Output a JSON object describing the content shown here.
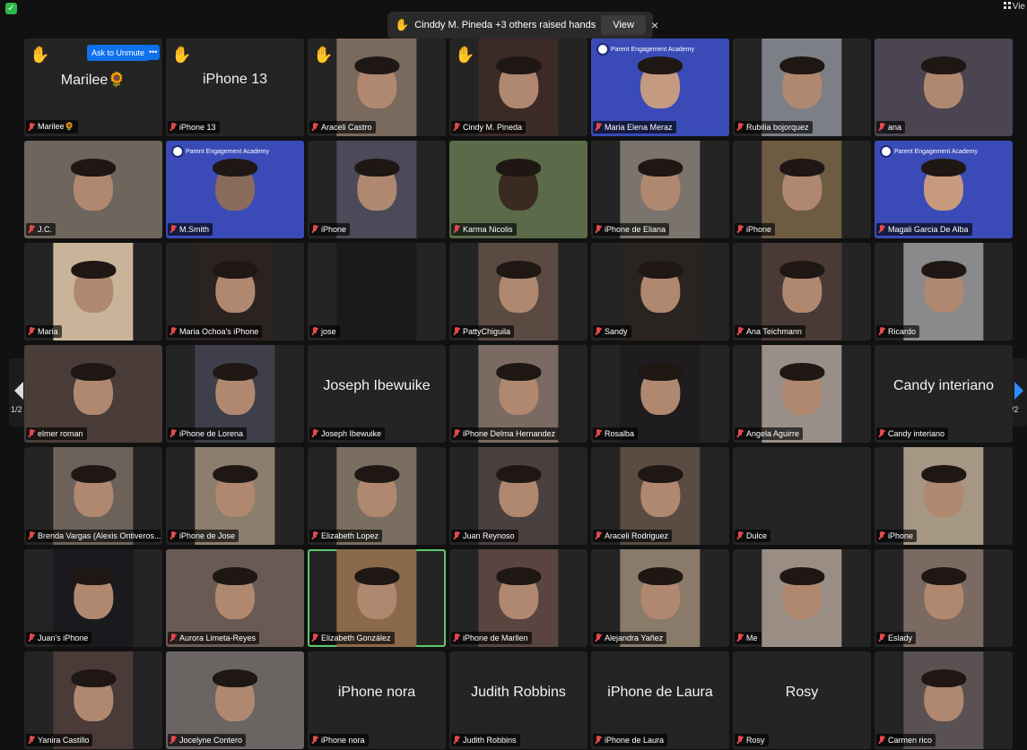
{
  "top": {
    "view_label": "Vie",
    "raise_banner": {
      "message": "Cinddy M. Pineda +3 others raised hands",
      "view_button": "View",
      "close": "×"
    }
  },
  "ask_to_unmute": "Ask to Unmute",
  "more": "•••",
  "academy_logo": "Parent Engagement Academy",
  "pager": {
    "left": "1/2",
    "right": "1/2"
  },
  "tiles": [
    {
      "label": "Marilee🌻",
      "big": "Marilee🌻",
      "hand": true,
      "ask": true
    },
    {
      "label": "iPhone 13",
      "big": "iPhone 13",
      "hand": true
    },
    {
      "label": "Araceli Castro",
      "hand": true,
      "video": "#7a6a5e"
    },
    {
      "label": "Cindy M. Pineda",
      "hand": true,
      "video": "#3b2a26"
    },
    {
      "label": "Maria Elena Meraz",
      "video": "#3a4bb8",
      "wide": true,
      "logo": true,
      "skin": "#c49a80"
    },
    {
      "label": "Rubilia bojorquez",
      "video": "#7d7f86"
    },
    {
      "label": "ana",
      "video": "#4a4550",
      "wide": true
    },
    {
      "label": "J.C.",
      "video": "#6e655c",
      "wide": true
    },
    {
      "label": "M.Smith",
      "video": "#3a4bb8",
      "wide": true,
      "logo": true,
      "skin": "#8a6a5a"
    },
    {
      "label": "iPhone",
      "video": "#4c4a58"
    },
    {
      "label": "Karma Nicolis",
      "video": "#5b6b4a",
      "wide": true,
      "skin": "#3a2a22"
    },
    {
      "label": "iPhone de Eliana",
      "video": "#7a746c"
    },
    {
      "label": "iPhone",
      "video": "#6d5c42"
    },
    {
      "label": "Magali Garcia De Alba",
      "video": "#3a4bb8",
      "wide": true,
      "logo": true,
      "skin": "#c79a7d"
    },
    {
      "label": "Maria",
      "video": "#c9b49a"
    },
    {
      "label": "Maria Ochoa's iPhone",
      "video": "#2b2320"
    },
    {
      "label": "jose",
      "video": "#1a1a1a"
    },
    {
      "label": "PattyChiguila",
      "video": "#5a4a42"
    },
    {
      "label": "Sandy",
      "video": "#2a2420"
    },
    {
      "label": "Ana Teichmann",
      "video": "#4a3a36"
    },
    {
      "label": "Ricardo",
      "video": "#8a8a8c"
    },
    {
      "label": "elmer roman",
      "video": "#4a3c38",
      "wide": true
    },
    {
      "label": "iPhone de Lorena",
      "video": "#3e3f4a"
    },
    {
      "label": "Joseph Ibewuike",
      "big": "Joseph Ibewuike"
    },
    {
      "label": "iPhone Delma Hernandez",
      "video": "#7a6a62"
    },
    {
      "label": "Rosalba",
      "video": "#1e1c1e"
    },
    {
      "label": "Angela Aguirre",
      "video": "#9a8f88"
    },
    {
      "label": "Candy interiano",
      "big": "Candy interiano"
    },
    {
      "label": "Brenda Vargas (Alexis Ontiveros...",
      "video": "#6c625a"
    },
    {
      "label": "iPhone de Jose",
      "video": "#8c7e6c"
    },
    {
      "label": "Elizabeth Lopez",
      "video": "#7a6e60"
    },
    {
      "label": "Juan Reynoso",
      "video": "#4a4040"
    },
    {
      "label": "Araceli Rodriguez",
      "video": "#5a4c42"
    },
    {
      "label": "Dulce",
      "video": "#242424"
    },
    {
      "label": "iPhone",
      "video": "#a69684"
    },
    {
      "label": "Juan's iPhone",
      "video": "#1a1a1e"
    },
    {
      "label": "Aurora Limeta-Reyes",
      "video": "#6a5a54",
      "wide": true
    },
    {
      "label": "Elizabeth González",
      "video": "#8a6a4a",
      "active": true
    },
    {
      "label": "iPhone de Marllen",
      "video": "#5a4440"
    },
    {
      "label": "Alejandra Yañez",
      "video": "#8a7a6a"
    },
    {
      "label": "Me",
      "video": "#9a8e84"
    },
    {
      "label": "Eslady",
      "video": "#7a6a62"
    },
    {
      "label": "Yanira Castillo",
      "video": "#4a3a38"
    },
    {
      "label": "Jocelyne Contero",
      "video": "#6a6462",
      "wide": true
    },
    {
      "label": "iPhone nora",
      "big": "iPhone nora"
    },
    {
      "label": "Judith Robbins",
      "big": "Judith Robbins"
    },
    {
      "label": "iPhone de Laura",
      "big": "iPhone de Laura"
    },
    {
      "label": "Rosy",
      "big": "Rosy"
    },
    {
      "label": "Carmen rico",
      "video": "#5a5252"
    }
  ]
}
